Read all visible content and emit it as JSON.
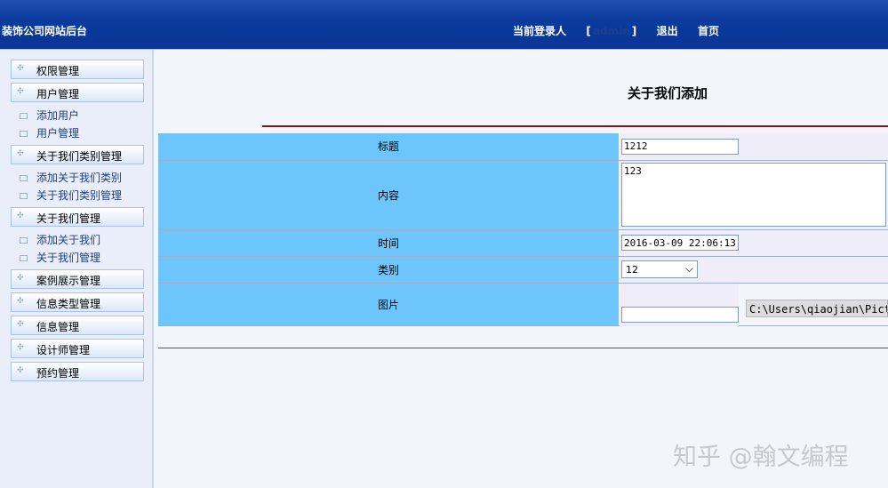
{
  "header": {
    "site_title": "装饰公司网站后台",
    "login_label": "当前登录人",
    "bracket_open": "[",
    "user": "admin",
    "bracket_close": "]",
    "logout": "退出",
    "home": "首页"
  },
  "sidebar": {
    "items": [
      {
        "label": "权限管理"
      },
      {
        "label": "用户管理"
      },
      {
        "label": "添加用户"
      },
      {
        "label": "用户管理"
      },
      {
        "label": "关于我们类别管理"
      },
      {
        "label": "添加关于我们类别"
      },
      {
        "label": "关于我们类别管理"
      },
      {
        "label": "关于我们管理"
      },
      {
        "label": "添加关于我们"
      },
      {
        "label": "关于我们管理"
      },
      {
        "label": "案例展示管理"
      },
      {
        "label": "信息类型管理"
      },
      {
        "label": "信息管理"
      },
      {
        "label": "设计师管理"
      },
      {
        "label": "预约管理"
      }
    ]
  },
  "main": {
    "page_title": "关于我们添加",
    "form": {
      "title_label": "标题",
      "title_value": "1212",
      "content_label": "内容",
      "content_value": "123",
      "time_label": "时间",
      "time_value": "2016-03-09 22:06:13",
      "category_label": "类别",
      "category_value": "12",
      "image_label": "图片",
      "image_value": "",
      "file_path": "C:\\Users\\qiaojian\\Pict"
    }
  },
  "watermark": "知乎 @翰文编程",
  "colors": {
    "header_bg": "#0b3596",
    "label_cell": "#6cc5fb",
    "value_cell": "#efedf8",
    "title_rule": "#7a1c1c"
  },
  "icons": {
    "menu_head": "plus-icon",
    "menu_sub": "box-icon",
    "select": "chevron-down-icon"
  }
}
